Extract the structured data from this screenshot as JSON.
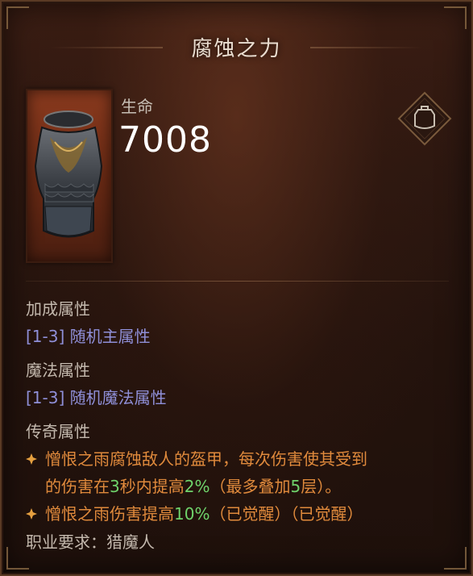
{
  "item": {
    "name": "腐蚀之力",
    "stat_label": "生命",
    "stat_value": "7008"
  },
  "icons": {
    "item_image": "chest-armor-icon",
    "slot": "chest-armor-slot-icon",
    "legendary_bullet": "diamond-star-icon"
  },
  "sections": {
    "bonus_title": "加成属性",
    "bonus_affix": "[1-3] 随机主属性",
    "magic_title": "魔法属性",
    "magic_affix": "[1-3] 随机魔法属性",
    "legendary_title": "传奇属性",
    "legendary_1": {
      "a": "憎恨之雨腐蚀敌人的盔甲，每次伤害使其受到",
      "b": "的伤害在",
      "n1": "3",
      "c": "秒内提高",
      "n2": "2%",
      "d": "（最多叠加",
      "n3": "5",
      "e": "层）。"
    },
    "legendary_2": {
      "a": "憎恨之雨伤害提高",
      "n1": "10%",
      "b": "（已觉醒）（已觉醒）"
    },
    "requirement": "职业要求：猎魔人"
  },
  "colors": {
    "title": "#e9ddd0",
    "magic_affix": "#8f8fd8",
    "legendary_text": "#e08a3c",
    "legendary_number": "#6fd36b",
    "stat_value": "#ffffff"
  }
}
